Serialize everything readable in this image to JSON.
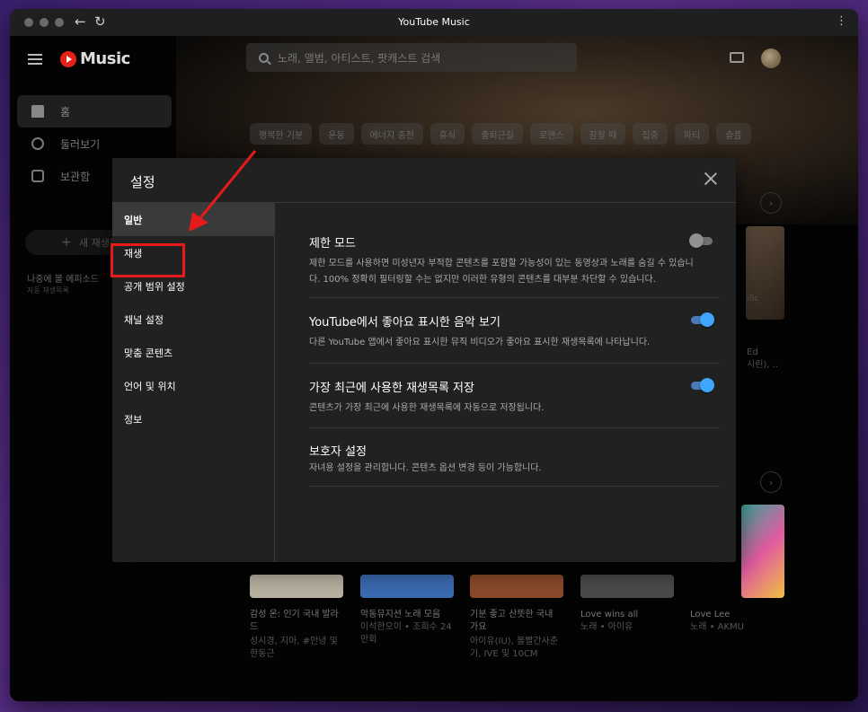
{
  "window": {
    "title": "YouTube Music"
  },
  "app": {
    "logo": "Music",
    "search_placeholder": "노래, 앨범, 아티스트, 팟캐스트 검색",
    "nav": [
      {
        "label": "홈",
        "icon": "home-icon"
      },
      {
        "label": "둘러보기",
        "icon": "compass-icon"
      },
      {
        "label": "보관함",
        "icon": "library-icon"
      }
    ],
    "new_playlist": "새 재생목록",
    "side_playlist": {
      "title": "나중에 볼 에피소드",
      "sub": "자동 재생목록"
    },
    "chips": [
      "행복한 기분",
      "운동",
      "에너지 충전",
      "휴식",
      "출퇴근길",
      "로맨스",
      "잠잘 때",
      "집중",
      "파티",
      "슬픔"
    ],
    "cards": [
      {
        "title": "감성 온: 인기 국내 발라드",
        "sub": "성시경, 지아, #안녕 및 한동근"
      },
      {
        "title": "악동뮤지션 노래 모음",
        "sub": "이석한오이 • 조회수 24만회"
      },
      {
        "title": "기분 좋고 산뜻한 국내 가요",
        "sub": "아이유(IU), 볼빨간사춘기, IVE 및 10CM"
      },
      {
        "title": "Love wins all",
        "sub": "노래 • 아이유"
      },
      {
        "title": "Love Lee",
        "sub": "노래 • AKMU"
      }
    ],
    "right_partial": {
      "line1": "Ed",
      "line2": "시린), ..",
      "line3": "ific"
    }
  },
  "modal": {
    "title": "설정",
    "sidebar": [
      "일반",
      "재생",
      "공개 범위 설정",
      "채널 설정",
      "맞춤 콘텐츠",
      "언어 및 위치",
      "정보"
    ],
    "active_index": 0,
    "settings": [
      {
        "title": "제한 모드",
        "desc": "제한 모드를 사용하면 미성년자 부적합 콘텐츠를 포함할 가능성이 있는 동영상과 노래를 숨길 수 있습니다. 100% 정확히 필터링할 수는 없지만 이러한 유형의 콘텐츠를 대부분 차단할 수 있습니다.",
        "toggle": false
      },
      {
        "title": "YouTube에서 좋아요 표시한 음악 보기",
        "desc": "다른 YouTube 앱에서 좋아요 표시한 뮤직 비디오가 좋아요 표시한 재생목록에 나타납니다.",
        "toggle": true
      },
      {
        "title": "가장 최근에 사용한 재생목록 저장",
        "desc": "콘텐츠가 가장 최근에 사용한 재생목록에 자동으로 저장됩니다.",
        "toggle": true
      },
      {
        "title": "보호자 설정",
        "desc": "자녀용 설정을 관리합니다. 콘텐츠 옵션 변경 등이 가능합니다.",
        "toggle": null
      }
    ]
  },
  "colors": {
    "annotation": "#e51b1b",
    "toggle_on": "#3ea6ff",
    "modal_bg": "#212121"
  }
}
